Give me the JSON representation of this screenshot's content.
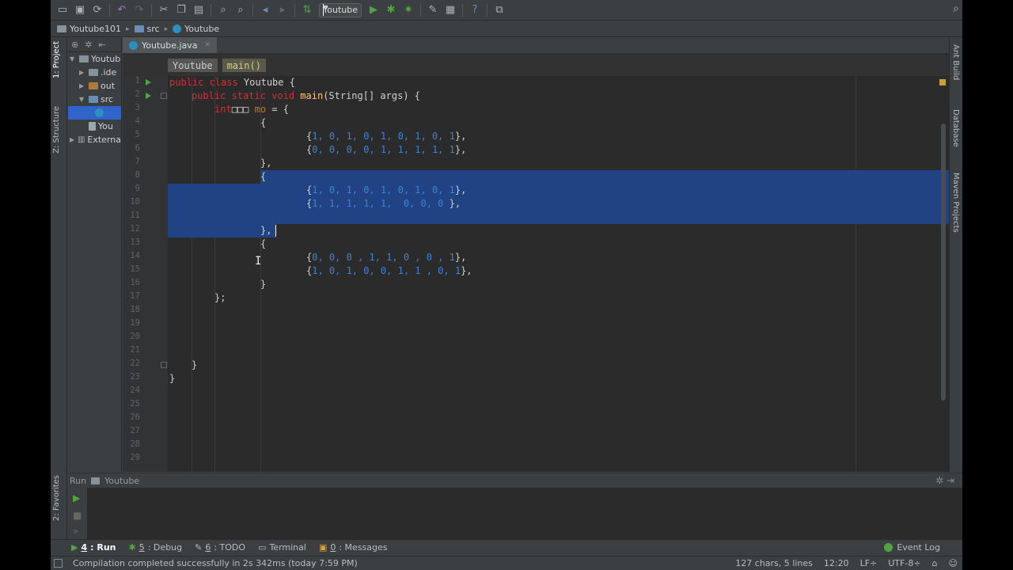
{
  "toolbar": {
    "run_config": "Youtube",
    "icons": [
      "open-folder",
      "save",
      "sync",
      "undo",
      "redo",
      "cut",
      "copy",
      "paste",
      "find",
      "replace",
      "back",
      "forward",
      "build",
      "run",
      "debug",
      "coverage",
      "project-structure",
      "sdk",
      "help",
      "vcs"
    ]
  },
  "navbar": {
    "project": "Youtube101",
    "folder": "src",
    "file": "Youtube"
  },
  "left_tabs": {
    "project": "1: Project",
    "structure": "Z: Structure",
    "favorites": "2: Favorites"
  },
  "project_tree": [
    {
      "label": "Youtub",
      "kind": "project",
      "expanded": true
    },
    {
      "label": ".ide",
      "kind": "folder",
      "expanded": false
    },
    {
      "label": "out",
      "kind": "folder-orange",
      "expanded": false
    },
    {
      "label": "src",
      "kind": "folder-blue",
      "expanded": true
    },
    {
      "label": "",
      "kind": "java-file",
      "selected": true
    },
    {
      "label": "You",
      "kind": "file"
    },
    {
      "label": "Externa",
      "kind": "library",
      "expanded": false
    }
  ],
  "editor": {
    "tab_label": "Youtube.java",
    "breadcrumb": [
      "Youtube",
      "main()"
    ],
    "line_numbers": [
      "1",
      "2",
      "3",
      "4",
      "5",
      "6",
      "7",
      "8",
      "9",
      "10",
      "11",
      "12",
      "13",
      "14",
      "15",
      "16",
      "17",
      "18",
      "19",
      "20",
      "21",
      "22",
      "23",
      "24",
      "25",
      "26",
      "27",
      "28",
      "29"
    ],
    "code": {
      "l1_kw": "public class ",
      "l1_id": "Youtube {",
      "l2_kw": "public static void ",
      "l2_fn": "main",
      "l2_rest": "(String[] args) {",
      "l3_kw": "int",
      "l3_glyphs": "□□□ ",
      "l3_var": "mo",
      "l3_rest": " = {",
      "open": "{",
      "r5": "1, 0, 1, 0, 1, 0, 1, 0, 1",
      "r6": "0, 0, 0, 0, 1, 1, 1, 1, 1",
      "r9": "1, 0, 1, 0, 1, 0, 1, 0, 1",
      "r10": "1, 1, 1, 1, 1,  0, 0, 0 ",
      "r14": "0, 0, 0 , 1, 1, 0 , 0 , 1",
      "r15": "1, 0, 1, 0, 0, 1, 1 , 0, 1",
      "close_comma": "},",
      "close": "}",
      "close_semi": "};"
    }
  },
  "right_tabs": {
    "ant": "Ant Build",
    "database": "Database",
    "maven": "Maven Projects"
  },
  "run_panel": {
    "label": "Run",
    "config": "Youtube"
  },
  "bottom_tabs": {
    "run_num": "4",
    "run_label": ": Run",
    "debug_num": "5",
    "debug_label": ": Debug",
    "todo_num": "6",
    "todo_label": ": TODO",
    "terminal_label": "Terminal",
    "messages_num": "0",
    "messages_label": ": Messages",
    "event_log": "Event Log"
  },
  "status": {
    "message": "Compilation completed successfully in 2s 342ms (today 7:59 PM)",
    "selection": "127 chars, 5 lines",
    "position": "12:20",
    "line_sep": "LF÷",
    "encoding": "UTF-8÷"
  },
  "colors": {
    "selection": "#214283",
    "keyword": "#cc3333",
    "number": "#3d82d6",
    "background": "#2b2b2b"
  }
}
